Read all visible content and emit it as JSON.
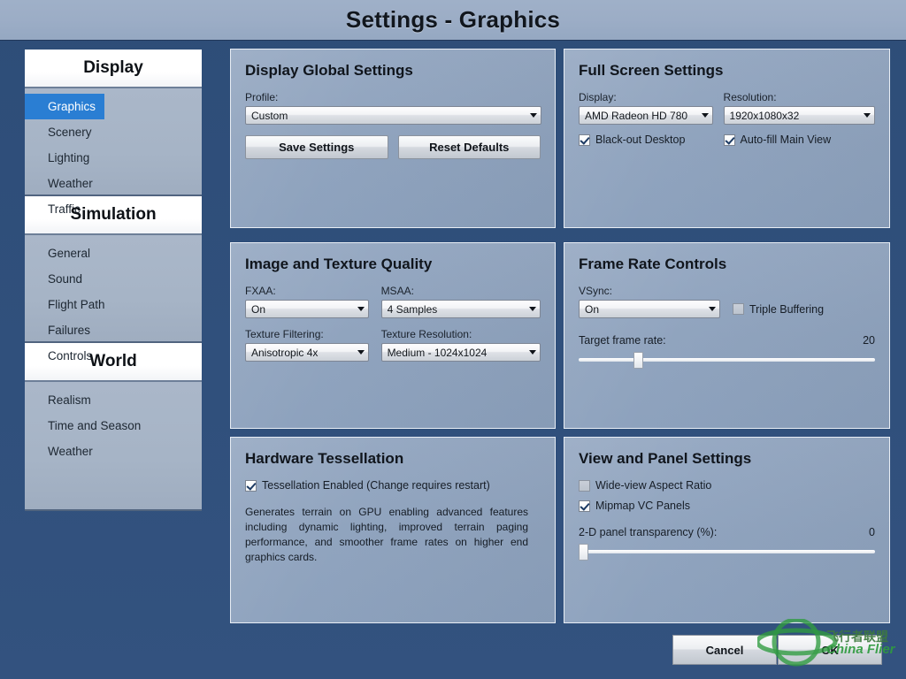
{
  "window": {
    "title": "Settings - Graphics"
  },
  "colors": {
    "accent_blue": "#2a7ed3",
    "panel_bg": "#8ea2bd",
    "window_bg": "#30507c",
    "titlebar_bg": "#9cadc6",
    "watermark_green": "#2f9b3f"
  },
  "sidebar": {
    "groups": [
      {
        "header": "Display",
        "items": [
          {
            "label": "Graphics",
            "selected": true
          },
          {
            "label": "Scenery",
            "selected": false
          },
          {
            "label": "Lighting",
            "selected": false
          },
          {
            "label": "Weather",
            "selected": false
          },
          {
            "label": "Traffic",
            "selected": false
          }
        ]
      },
      {
        "header": "Simulation",
        "items": [
          {
            "label": "General",
            "selected": false
          },
          {
            "label": "Sound",
            "selected": false
          },
          {
            "label": "Flight Path",
            "selected": false
          },
          {
            "label": "Failures",
            "selected": false
          },
          {
            "label": "Controls",
            "selected": false
          }
        ]
      },
      {
        "header": "World",
        "items": [
          {
            "label": "Realism",
            "selected": false
          },
          {
            "label": "Time and Season",
            "selected": false
          },
          {
            "label": "Weather",
            "selected": false
          }
        ]
      }
    ]
  },
  "panels": {
    "display_global": {
      "title": "Display Global Settings",
      "profile_label": "Profile:",
      "profile_value": "Custom",
      "save_label": "Save Settings",
      "reset_label": "Reset Defaults"
    },
    "full_screen": {
      "title": "Full Screen Settings",
      "display_label": "Display:",
      "display_value": "AMD Radeon HD 780",
      "resolution_label": "Resolution:",
      "resolution_value": "1920x1080x32",
      "blackout_label": "Black-out Desktop",
      "blackout_checked": true,
      "autofill_label": "Auto-fill Main View",
      "autofill_checked": true
    },
    "image_texture": {
      "title": "Image and Texture Quality",
      "fxaa_label": "FXAA:",
      "fxaa_value": "On",
      "msaa_label": "MSAA:",
      "msaa_value": "4 Samples",
      "filtering_label": "Texture Filtering:",
      "filtering_value": "Anisotropic 4x",
      "resolution_label": "Texture Resolution:",
      "resolution_value": "Medium - 1024x1024"
    },
    "frame_rate": {
      "title": "Frame Rate Controls",
      "vsync_label": "VSync:",
      "vsync_value": "On",
      "triple_buffering_label": "Triple Buffering",
      "triple_buffering_checked": false,
      "target_label": "Target frame rate:",
      "target_value": "20",
      "target_percent": 19
    },
    "tessellation": {
      "title": "Hardware Tessellation",
      "enabled_label": "Tessellation Enabled (Change requires restart)",
      "enabled_checked": true,
      "description": "Generates terrain on GPU enabling advanced features including dynamic lighting, improved terrain paging performance, and smoother frame rates on higher end graphics cards."
    },
    "view_panel": {
      "title": "View and Panel Settings",
      "wideview_label": "Wide-view Aspect Ratio",
      "wideview_checked": false,
      "mipmap_label": "Mipmap VC Panels",
      "mipmap_checked": true,
      "transparency_label": "2-D panel transparency (%):",
      "transparency_value": "0",
      "transparency_percent": 0
    }
  },
  "footer": {
    "cancel_label": "Cancel",
    "ok_label": "OK"
  },
  "watermark": {
    "icon": "globe-logo-icon",
    "chinese_text": "飞行者联盟",
    "english_text": "China Flier"
  }
}
